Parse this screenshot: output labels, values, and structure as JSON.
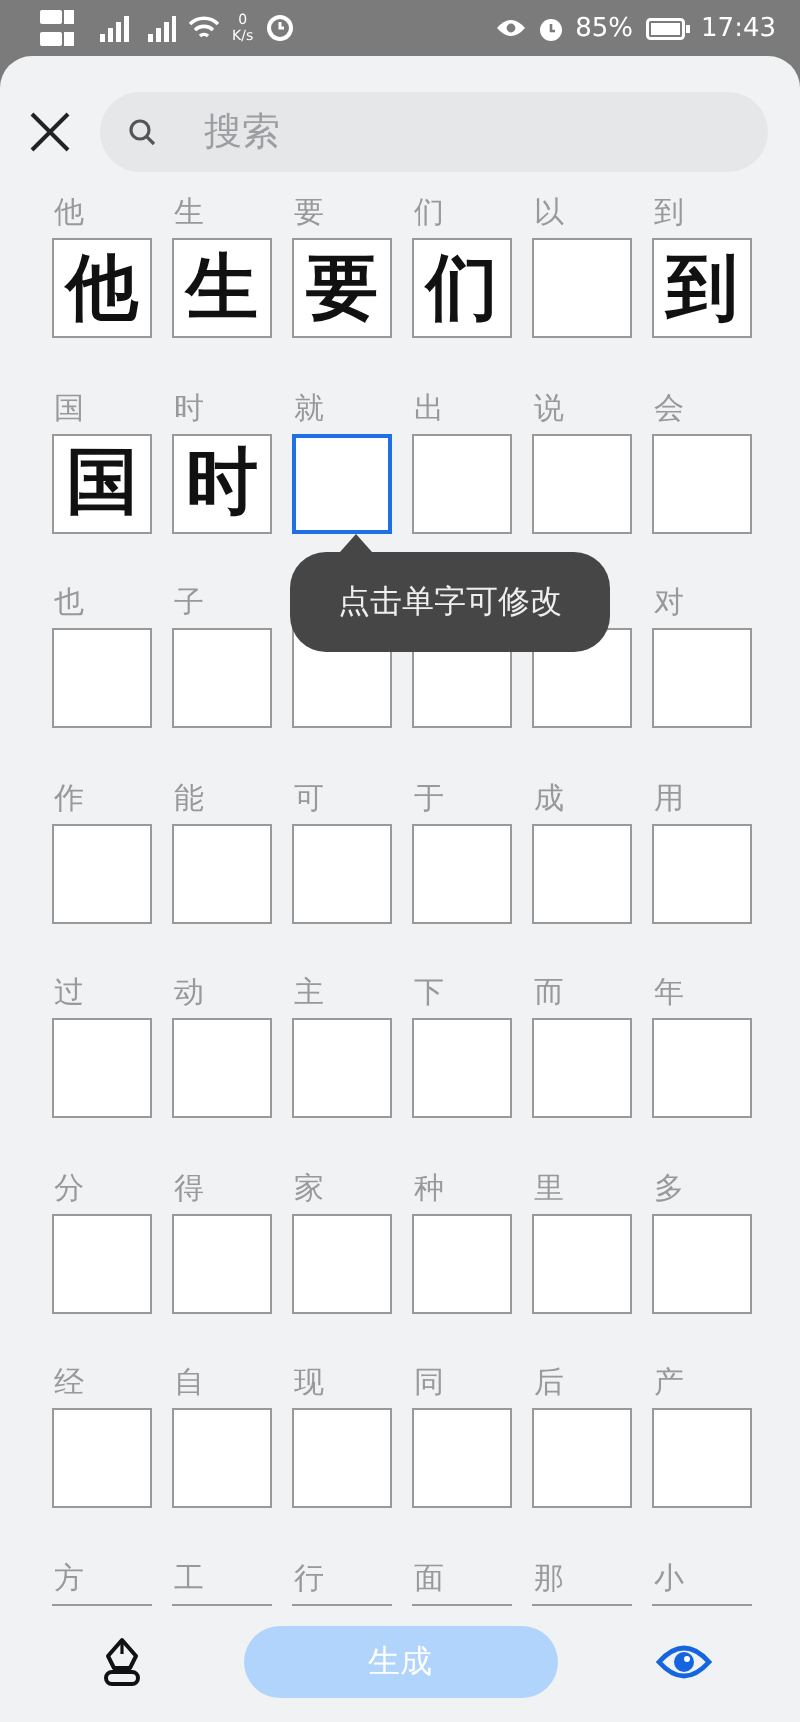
{
  "status_bar": {
    "speed_value": "0",
    "speed_unit": "K/s",
    "battery": "85%",
    "time": "17:43"
  },
  "search": {
    "placeholder": "搜索"
  },
  "grid": [
    [
      {
        "label": "他",
        "written": "他",
        "selected": false
      },
      {
        "label": "生",
        "written": "生",
        "selected": false
      },
      {
        "label": "要",
        "written": "要",
        "selected": false
      },
      {
        "label": "们",
        "written": "们",
        "selected": false
      },
      {
        "label": "以",
        "selected": false
      },
      {
        "label": "到",
        "written": "到",
        "selected": false
      }
    ],
    [
      {
        "label": "国",
        "written": "国",
        "selected": false
      },
      {
        "label": "时",
        "written": "时",
        "selected": false
      },
      {
        "label": "就",
        "selected": true
      },
      {
        "label": "出",
        "selected": false
      },
      {
        "label": "说",
        "selected": false
      },
      {
        "label": "会",
        "selected": false
      }
    ],
    [
      {
        "label": "也",
        "selected": false
      },
      {
        "label": "子",
        "selected": false
      },
      {
        "selected": false
      },
      {
        "selected": false
      },
      {
        "selected": false
      },
      {
        "label": "对",
        "selected": false
      }
    ],
    [
      {
        "label": "作",
        "selected": false
      },
      {
        "label": "能",
        "selected": false
      },
      {
        "label": "可",
        "selected": false
      },
      {
        "label": "于",
        "selected": false
      },
      {
        "label": "成",
        "selected": false
      },
      {
        "label": "用",
        "selected": false
      }
    ],
    [
      {
        "label": "过",
        "selected": false
      },
      {
        "label": "动",
        "selected": false
      },
      {
        "label": "主",
        "selected": false
      },
      {
        "label": "下",
        "selected": false
      },
      {
        "label": "而",
        "selected": false
      },
      {
        "label": "年",
        "selected": false
      }
    ],
    [
      {
        "label": "分",
        "selected": false
      },
      {
        "label": "得",
        "selected": false
      },
      {
        "label": "家",
        "selected": false
      },
      {
        "label": "种",
        "selected": false
      },
      {
        "label": "里",
        "selected": false
      },
      {
        "label": "多",
        "selected": false
      }
    ],
    [
      {
        "label": "经",
        "selected": false
      },
      {
        "label": "自",
        "selected": false
      },
      {
        "label": "现",
        "selected": false
      },
      {
        "label": "同",
        "selected": false
      },
      {
        "label": "后",
        "selected": false
      },
      {
        "label": "产",
        "selected": false
      }
    ],
    [
      {
        "label": "方",
        "selected": false
      },
      {
        "label": "工",
        "selected": false
      },
      {
        "label": "行",
        "selected": false
      },
      {
        "label": "面",
        "selected": false
      },
      {
        "label": "那",
        "selected": false
      },
      {
        "label": "小",
        "selected": false
      }
    ]
  ],
  "tooltip": "点击单字可修改",
  "generate_button": {
    "label": "生成",
    "disabled": true
  }
}
